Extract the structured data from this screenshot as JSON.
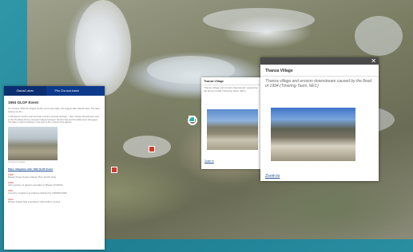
{
  "panel": {
    "tabs": [
      "Glacial Lakes",
      "Pho Chu sub-basin",
      ""
    ],
    "title": "1994 GLOF Event",
    "paragraphs": [
      "On October 1994 the largest GLOF event took place; the biggest lake Glacial Lake. The lake, drained as the...",
      "to 68 lateral moraine and terminal moraine causing damage... later release downstream and to the Punakha Dzong. Houses bridges between Samdrozha and Punakha were damaged. The lake is still increasing in size due to the retreat of the glacier."
    ],
    "photo_caption": "Thorthormi Glacier",
    "link": "Major mitigation after 1994 GLOF Event",
    "items": [
      {
        "year": "1998",
        "text": "Bhutan Power System Master Plan: GLOF study"
      },
      {
        "year": "1999",
        "text": "GIS inventory of glaciers and lakes in Bhutan (ICIMOD)"
      },
      {
        "year": "2001",
        "text": "Inventory of glaciers and lakes published by ICIMOD/UNEP"
      },
      {
        "year": "2002",
        "text": "Bhutan funded field expeditions with DGM to Lunana"
      }
    ]
  },
  "popup_small": {
    "title": "Thanza Village",
    "desc": "Thanza village and erosion downstream caused by the flood of 1994 (Tshering Tashi, NEC)",
    "zoom": "Zoom to"
  },
  "popup_big": {
    "close": "✕",
    "title": "Thanza Village",
    "desc": "Thanza village and erosion downstream caused by the flood of 1994.(Tshering Tashi, NEC)",
    "zoom": "Zoom to"
  },
  "colors": {
    "background": "#1f7f93",
    "panel_header": "#0d3a8a",
    "marker_red": "#d03a2c",
    "marker_teal": "#2fb3a5"
  }
}
